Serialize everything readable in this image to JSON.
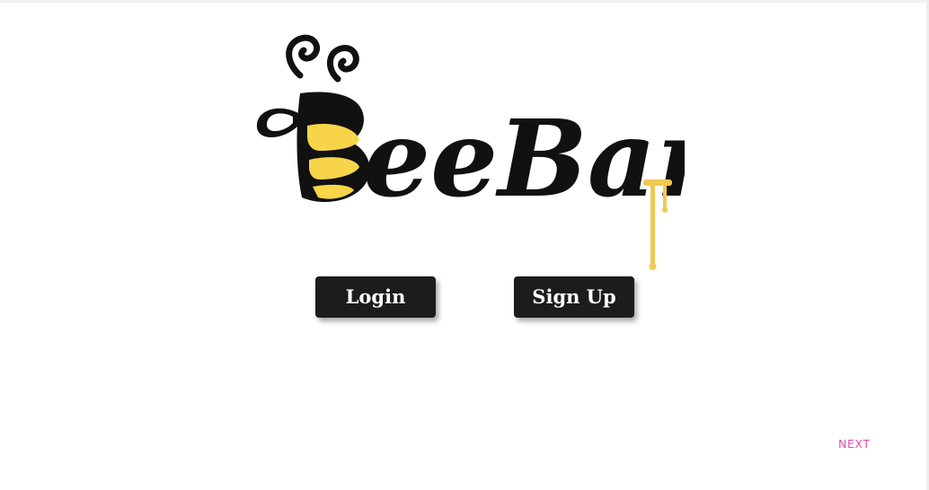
{
  "brand": {
    "logo_text": "BeeBank",
    "logo_icon": "bee-icon",
    "colors": {
      "bee_yellow": "#f8d548",
      "ink": "#111111",
      "honey": "#f1c94f"
    }
  },
  "actions": {
    "login_label": "Login",
    "signup_label": "Sign Up"
  },
  "footer": {
    "next_label": "NEXT",
    "next_color": "#e24cb8"
  }
}
